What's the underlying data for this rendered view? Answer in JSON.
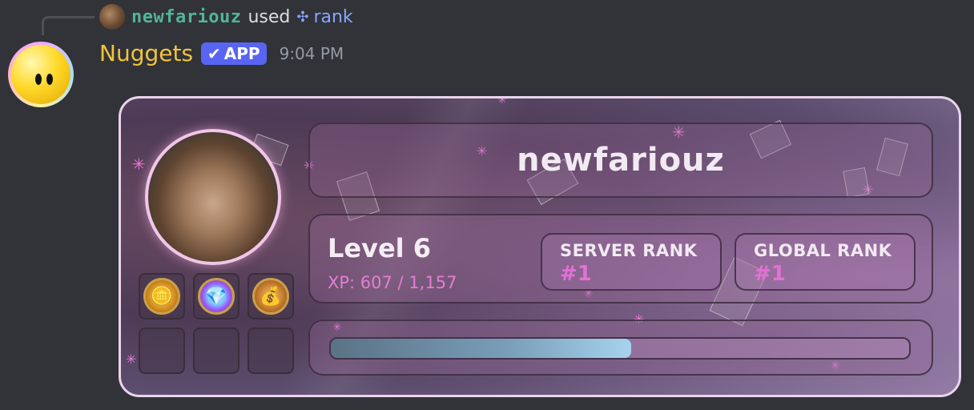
{
  "reply": {
    "username": "newfariouz",
    "used_text": "used",
    "command": "rank",
    "command_icon": "slash-command-icon"
  },
  "message": {
    "bot_name": "Nuggets",
    "badge_label": "APP",
    "badge_icon": "checkmark-icon",
    "timestamp": "9:04 PM"
  },
  "rank_card": {
    "username": "newfariouz",
    "level_label": "Level 6",
    "xp_text": "XP: 607 / 1,157",
    "xp_current": 607,
    "xp_required": 1157,
    "progress_fraction": 0.52,
    "server_rank_label": "SERVER RANK",
    "server_rank_value": "#1",
    "global_rank_label": "GLOBAL RANK",
    "global_rank_value": "#1",
    "badges": [
      {
        "name": "gold-coins-badge-icon",
        "glyph": "🪙"
      },
      {
        "name": "gems-badge-icon",
        "glyph": "💎"
      },
      {
        "name": "money-bag-badge-icon",
        "glyph": "💰"
      }
    ],
    "empty_badge_slots": 3
  },
  "colors": {
    "background": "#313338",
    "reply_username": "#53b49a",
    "command": "#87a6ff",
    "bot_name": "#f0c43a",
    "app_badge": "#5865f2",
    "rank_pink": "#e470d6",
    "progress_fill": "#7a9fba"
  }
}
